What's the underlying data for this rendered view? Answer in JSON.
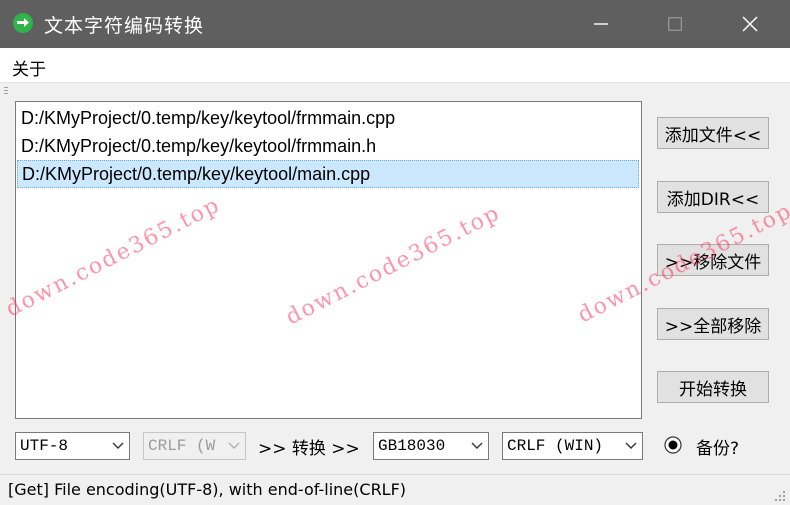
{
  "window": {
    "title": "文本字符编码转换"
  },
  "menu": {
    "items": [
      "关于"
    ]
  },
  "files": [
    "D:/KMyProject/0.temp/key/keytool/frmmain.cpp",
    "D:/KMyProject/0.temp/key/keytool/frmmain.h",
    "D:/KMyProject/0.temp/key/keytool/main.cpp"
  ],
  "selected_file_index": 2,
  "buttons": {
    "add_file": "添加文件<<",
    "add_dir": "添加DIR<<",
    "remove_file": ">>移除文件",
    "remove_all": ">>全部移除",
    "start": "开始转换"
  },
  "controls": {
    "source_encoding": "UTF-8",
    "source_eol": "CRLF (W",
    "convert_label": ">> 转换 >>",
    "target_encoding": "GB18030",
    "target_eol": "CRLF (WIN)",
    "backup_label": "备份?",
    "backup_checked": true
  },
  "status": "[Get] File encoding(UTF-8), with end-of-line(CRLF)",
  "watermark": "down.code365.top",
  "colors": {
    "titlebar": "#5f5f5f",
    "selection": "#cce8ff",
    "watermark": "#ff3c64"
  }
}
